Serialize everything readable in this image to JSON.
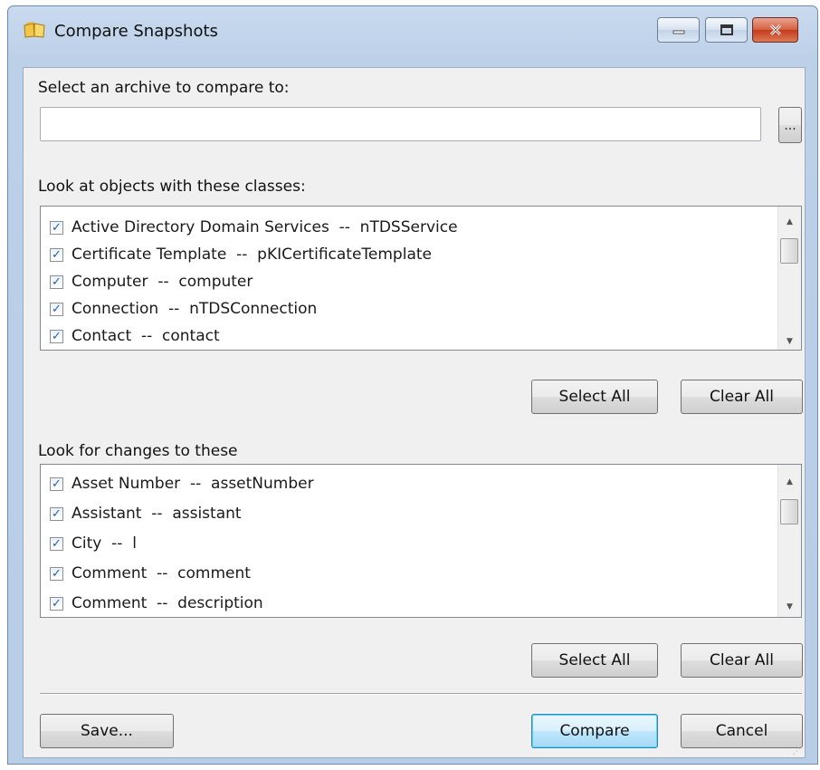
{
  "window": {
    "title": "Compare Snapshots",
    "icon": "folder-book-icon"
  },
  "archive": {
    "label": "Select an archive to compare to:",
    "value": "",
    "browse_label": "..."
  },
  "classes": {
    "label": "Look at objects with these classes:",
    "items": [
      {
        "label": "Active Directory Domain Services  --  nTDSService",
        "checked": true
      },
      {
        "label": "Certificate Template  --  pKICertificateTemplate",
        "checked": true
      },
      {
        "label": "Computer  --  computer",
        "checked": true
      },
      {
        "label": "Connection  --  nTDSConnection",
        "checked": true
      },
      {
        "label": "Contact  --  contact",
        "checked": true
      }
    ],
    "select_all_label": "Select All",
    "clear_all_label": "Clear All"
  },
  "attributes": {
    "label": "Look for changes to these",
    "items": [
      {
        "label": "Asset Number  --  assetNumber",
        "checked": true
      },
      {
        "label": "Assistant  --  assistant",
        "checked": true
      },
      {
        "label": "City  --  l",
        "checked": true
      },
      {
        "label": "Comment  --  comment",
        "checked": true
      },
      {
        "label": "Comment  --  description",
        "checked": true
      }
    ],
    "select_all_label": "Select All",
    "clear_all_label": "Clear All"
  },
  "footer": {
    "save_label": "Save...",
    "compare_label": "Compare",
    "cancel_label": "Cancel"
  },
  "glyphs": {
    "check": "✓",
    "up": "▲",
    "down": "▼",
    "grip": "⋰"
  }
}
